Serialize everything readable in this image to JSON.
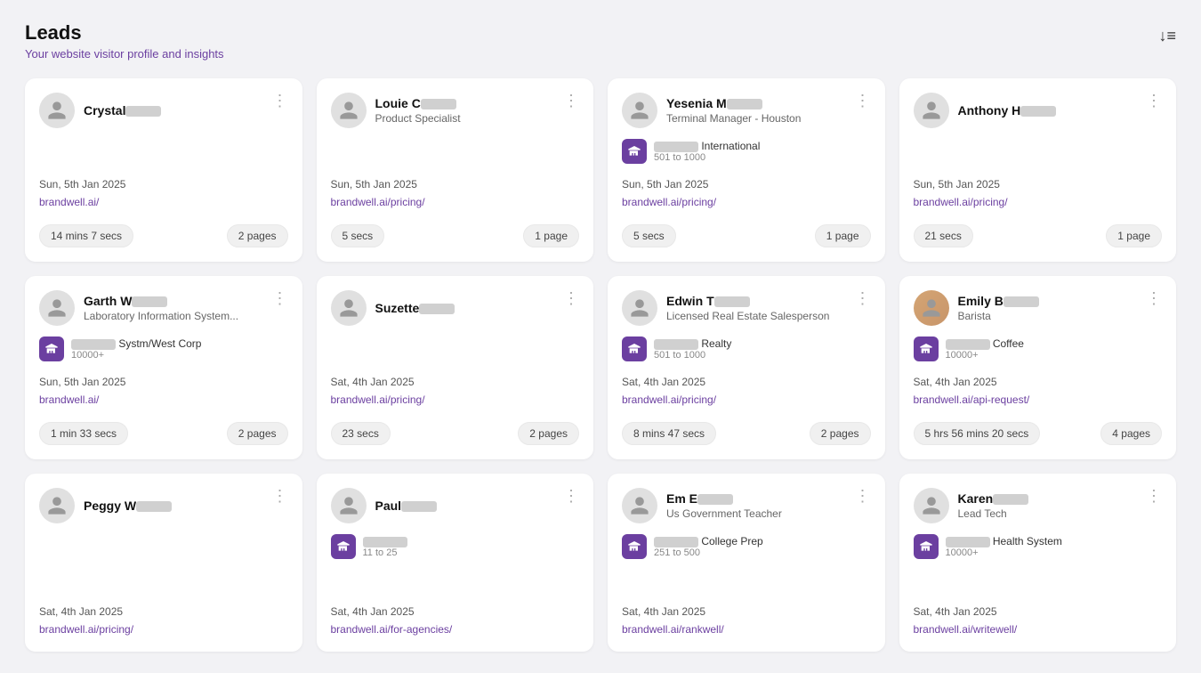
{
  "header": {
    "title": "Leads",
    "subtitle_start": "Your website visitor profile ",
    "subtitle_link": "and insights"
  },
  "leads": [
    {
      "id": 1,
      "name": "Crystal",
      "name_blurred": true,
      "role": "",
      "has_company": false,
      "date": "Sun, 5th Jan 2025",
      "link": "brandwell.ai/",
      "time": "14 mins 7 secs",
      "pages": "2 pages",
      "has_avatar": false,
      "avatar_type": "default"
    },
    {
      "id": 2,
      "name": "Louie C",
      "name_blurred": true,
      "role": "Product Specialist",
      "has_company": false,
      "date": "Sun, 5th Jan 2025",
      "link": "brandwell.ai/pricing/",
      "time": "5 secs",
      "pages": "1 page",
      "has_avatar": false,
      "avatar_type": "default"
    },
    {
      "id": 3,
      "name": "Yesenia M",
      "name_blurred": true,
      "role": "Terminal Manager - Houston",
      "has_company": true,
      "company_name": "International",
      "company_name_blurred": true,
      "company_size": "501 to 1000",
      "date": "Sun, 5th Jan 2025",
      "link": "brandwell.ai/pricing/",
      "time": "5 secs",
      "pages": "1 page",
      "has_avatar": false,
      "avatar_type": "default"
    },
    {
      "id": 4,
      "name": "Anthony H",
      "name_blurred": true,
      "role": "",
      "has_company": false,
      "date": "Sun, 5th Jan 2025",
      "link": "brandwell.ai/pricing/",
      "time": "21 secs",
      "pages": "1 page",
      "has_avatar": false,
      "avatar_type": "default"
    },
    {
      "id": 5,
      "name": "Garth W",
      "name_blurred": true,
      "role": "Laboratory Information System...",
      "has_company": true,
      "company_name": "Systm/West Corp",
      "company_name_blurred": true,
      "company_size": "10000+",
      "date": "Sun, 5th Jan 2025",
      "link": "brandwell.ai/",
      "time": "1 min 33 secs",
      "pages": "2 pages",
      "has_avatar": false,
      "avatar_type": "default"
    },
    {
      "id": 6,
      "name": "Suzette",
      "name_blurred": true,
      "role": "",
      "has_company": false,
      "date": "Sat, 4th Jan 2025",
      "link": "brandwell.ai/pricing/",
      "time": "23 secs",
      "pages": "2 pages",
      "has_avatar": false,
      "avatar_type": "default"
    },
    {
      "id": 7,
      "name": "Edwin T",
      "name_blurred": true,
      "role": "Licensed Real Estate Salesperson",
      "has_company": true,
      "company_name": "Realty",
      "company_name_blurred": true,
      "company_size": "501 to 1000",
      "date": "Sat, 4th Jan 2025",
      "link": "brandwell.ai/pricing/",
      "time": "8 mins 47 secs",
      "pages": "2 pages",
      "has_avatar": false,
      "avatar_type": "default"
    },
    {
      "id": 8,
      "name": "Emily B",
      "name_blurred": true,
      "role": "Barista",
      "has_company": true,
      "company_name": "Coffee",
      "company_name_blurred": true,
      "company_size": "10000+",
      "date": "Sat, 4th Jan 2025",
      "link": "brandwell.ai/api-request/",
      "time": "5 hrs 56 mins 20 secs",
      "pages": "4 pages",
      "has_avatar": true,
      "avatar_type": "photo",
      "avatar_color": "#c8a882"
    },
    {
      "id": 9,
      "name": "Peggy W",
      "name_blurred": true,
      "role": "",
      "has_company": false,
      "date": "Sat, 4th Jan 2025",
      "link": "brandwell.ai/pricing/",
      "time": "",
      "pages": "",
      "has_avatar": false,
      "avatar_type": "default"
    },
    {
      "id": 10,
      "name": "Paul",
      "name_blurred": true,
      "role": "",
      "has_company": true,
      "company_name": "",
      "company_name_blurred": true,
      "company_size": "11 to 25",
      "date": "Sat, 4th Jan 2025",
      "link": "brandwell.ai/for-agencies/",
      "time": "",
      "pages": "",
      "has_avatar": false,
      "avatar_type": "default"
    },
    {
      "id": 11,
      "name": "Em E",
      "name_blurred": true,
      "role": "Us Government Teacher",
      "has_company": true,
      "company_name": "College Prep",
      "company_name_blurred": true,
      "company_size": "251 to 500",
      "date": "Sat, 4th Jan 2025",
      "link": "brandwell.ai/rankwell/",
      "time": "",
      "pages": "",
      "has_avatar": false,
      "avatar_type": "default"
    },
    {
      "id": 12,
      "name": "Karen",
      "name_blurred": true,
      "role": "Lead Tech",
      "has_company": true,
      "company_name": "Health System",
      "company_name_blurred": true,
      "company_size": "10000+",
      "date": "Sat, 4th Jan 2025",
      "link": "brandwell.ai/writewell/",
      "time": "",
      "pages": "",
      "has_avatar": false,
      "avatar_type": "default"
    }
  ]
}
